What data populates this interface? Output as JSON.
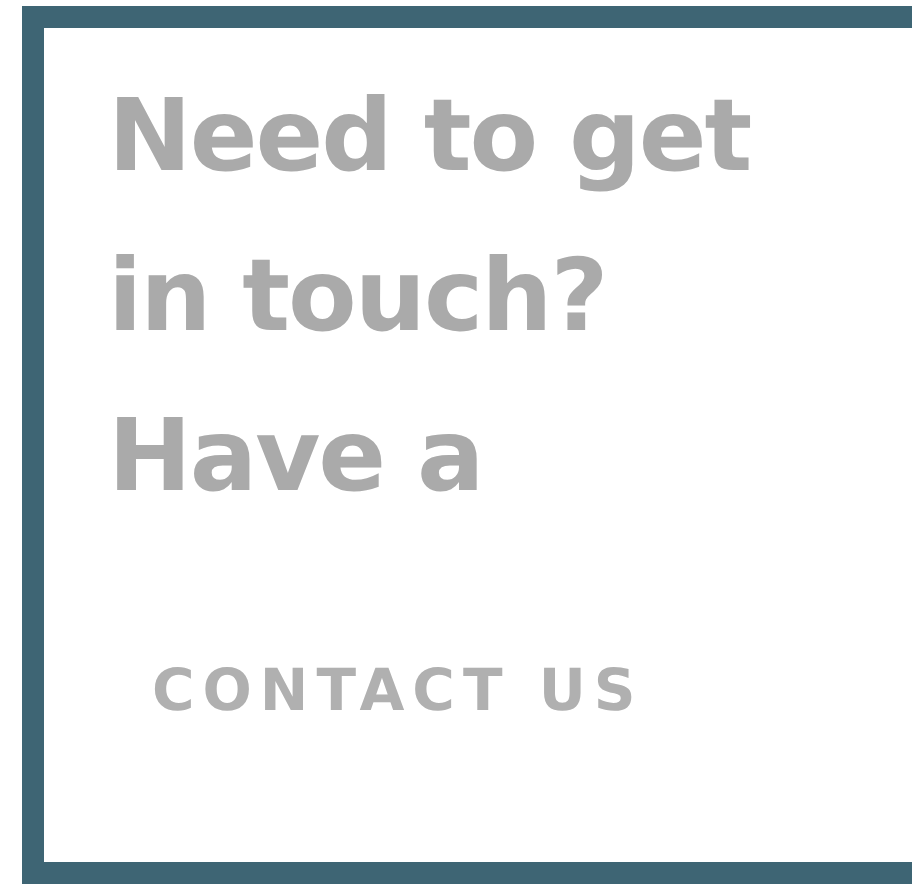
{
  "heading": "Need to get in touch?",
  "subheading": "Have a",
  "button": {
    "label": "CONTACT US"
  }
}
